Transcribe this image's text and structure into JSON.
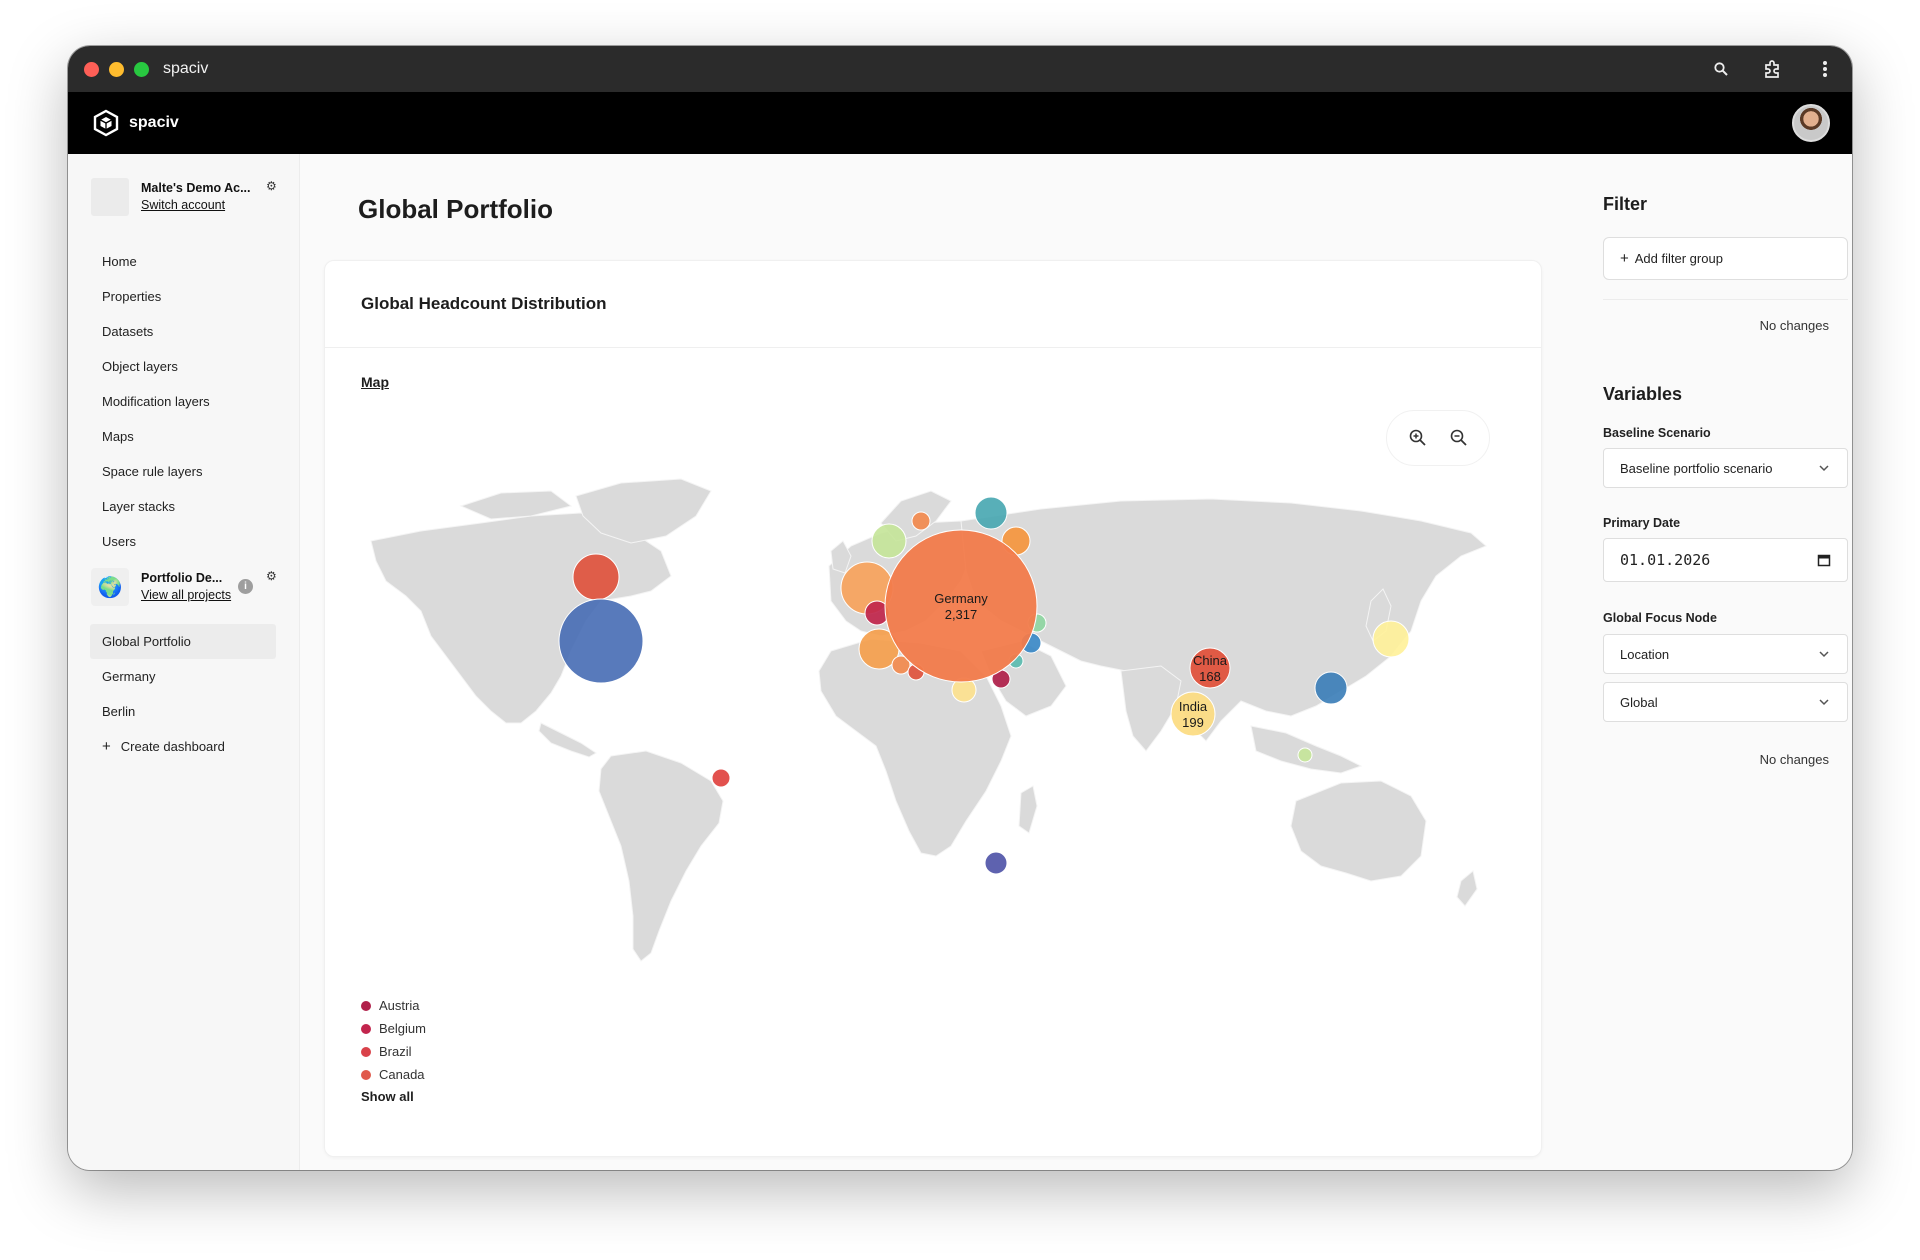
{
  "window": {
    "title": "spaciv"
  },
  "appbar": {
    "brand": "spaciv"
  },
  "account": {
    "name": "Malte's Demo Ac...",
    "switch_label": "Switch account"
  },
  "nav": {
    "items": [
      {
        "label": "Home"
      },
      {
        "label": "Properties"
      },
      {
        "label": "Datasets"
      },
      {
        "label": "Object layers"
      },
      {
        "label": "Modification layers"
      },
      {
        "label": "Maps"
      },
      {
        "label": "Space rule layers"
      },
      {
        "label": "Layer stacks"
      },
      {
        "label": "Users"
      }
    ]
  },
  "project": {
    "name": "Portfolio De...",
    "view_all_label": "View all projects",
    "info": "i"
  },
  "dashboards": {
    "items": [
      {
        "label": "Global Portfolio",
        "active": true
      },
      {
        "label": "Germany"
      },
      {
        "label": "Berlin"
      }
    ],
    "create_label": "Create dashboard"
  },
  "main": {
    "title": "Global Portfolio",
    "card_title": "Global Headcount Distribution",
    "map_tab": "Map",
    "show_all": "Show all",
    "legend": [
      {
        "label": "Austria",
        "color": "#b0204a"
      },
      {
        "label": "Belgium",
        "color": "#c2254d"
      },
      {
        "label": "Brazil",
        "color": "#d9424a"
      },
      {
        "label": "Canada",
        "color": "#e05a4c"
      }
    ]
  },
  "chart_data": {
    "type": "scatter",
    "subtype": "bubble-map",
    "labeled_bubbles": [
      {
        "label": "Germany",
        "value": "2,317",
        "color": "#f27b4b"
      },
      {
        "label": "India",
        "value": "199",
        "color": "#fcdc84"
      },
      {
        "label": "China",
        "value": "168",
        "color": "#e0533d"
      }
    ],
    "legend": [
      "Austria",
      "Belgium",
      "Brazil",
      "Canada"
    ]
  },
  "filter": {
    "title": "Filter",
    "add_group_label": "Add filter group",
    "status": "No changes"
  },
  "variables": {
    "title": "Variables",
    "baseline_label": "Baseline Scenario",
    "baseline_value": "Baseline portfolio scenario",
    "date_label": "Primary Date",
    "date_value": "01.01.2026",
    "focus_label": "Global Focus Node",
    "focus_type": "Location",
    "focus_value": "Global",
    "status": "No changes"
  }
}
